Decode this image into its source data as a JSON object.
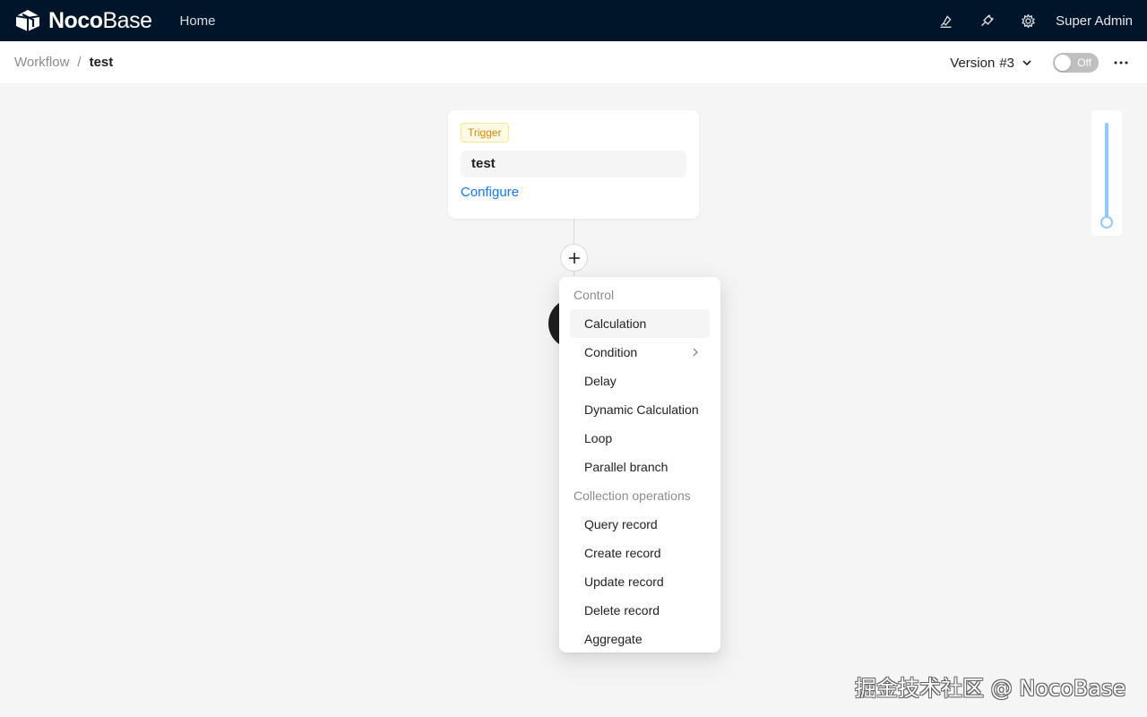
{
  "app": {
    "logo_bold": "Noco",
    "logo_light": "Base",
    "nav_home": "Home",
    "user_name": "Super Admin",
    "icons": [
      "highlighter-icon",
      "plugin-icon",
      "settings-icon"
    ]
  },
  "breadcrumb": {
    "parent": "Workflow",
    "separator": "/",
    "current": "test"
  },
  "version": {
    "label": "Version",
    "number": "#3"
  },
  "toggle": {
    "label": "Off",
    "on": false
  },
  "trigger": {
    "tag": "Trigger",
    "title": "test",
    "configure": "Configure"
  },
  "menu": {
    "groups": [
      {
        "label": "Control",
        "items": [
          "Calculation",
          "Condition",
          "Delay",
          "Dynamic Calculation",
          "Loop",
          "Parallel branch"
        ]
      },
      {
        "label": "Collection operations",
        "items": [
          "Query record",
          "Create record",
          "Update record",
          "Delete record",
          "Aggregate"
        ]
      }
    ]
  },
  "zoom": {
    "level": 1.0
  },
  "watermark": "掘金技术社区 @ NocoBase",
  "colors": {
    "header_bg": "#001529",
    "link": "#1677ff",
    "trigger_tag": "#d48806",
    "zoom_track": "#91caff"
  }
}
